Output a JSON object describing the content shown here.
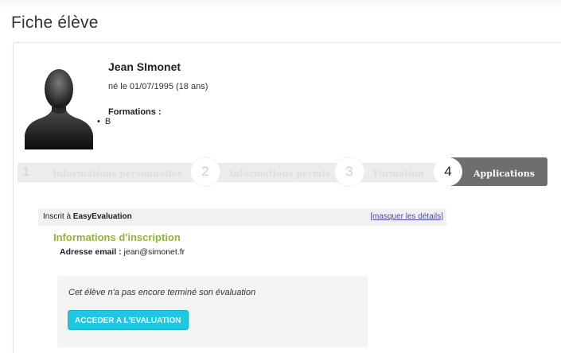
{
  "page": {
    "title": "Fiche élève"
  },
  "student": {
    "name": "Jean SImonet",
    "birth": "né le 01/07/1995 (18 ans)",
    "formations_label": "Formations :",
    "formations": [
      "B"
    ]
  },
  "steps": [
    {
      "number": "1",
      "label": "Informations personnelles",
      "active": false
    },
    {
      "number": "2",
      "label": "Informations permis",
      "active": false
    },
    {
      "number": "3",
      "label": "Formation",
      "active": false
    },
    {
      "number": "4",
      "label": "Applications",
      "active": true
    }
  ],
  "subscription": {
    "prefix": "Inscrit à ",
    "app_name": "EasyEvaluation",
    "toggle_label": "[masquer les détails]",
    "section_title": "Informations d'inscription",
    "email_label": "Adresse email :",
    "email_value": " jean@simonet.fr"
  },
  "evaluation": {
    "message": "Cet élève n'a pas encore terminé son évaluation",
    "button_label": "ACCEDER A L'EVALUATION"
  },
  "colors": {
    "accent_green": "#8fb339",
    "button_cyan": "#1fc7e3",
    "active_step": "#6e6e6e",
    "link": "#4a4aa8"
  }
}
